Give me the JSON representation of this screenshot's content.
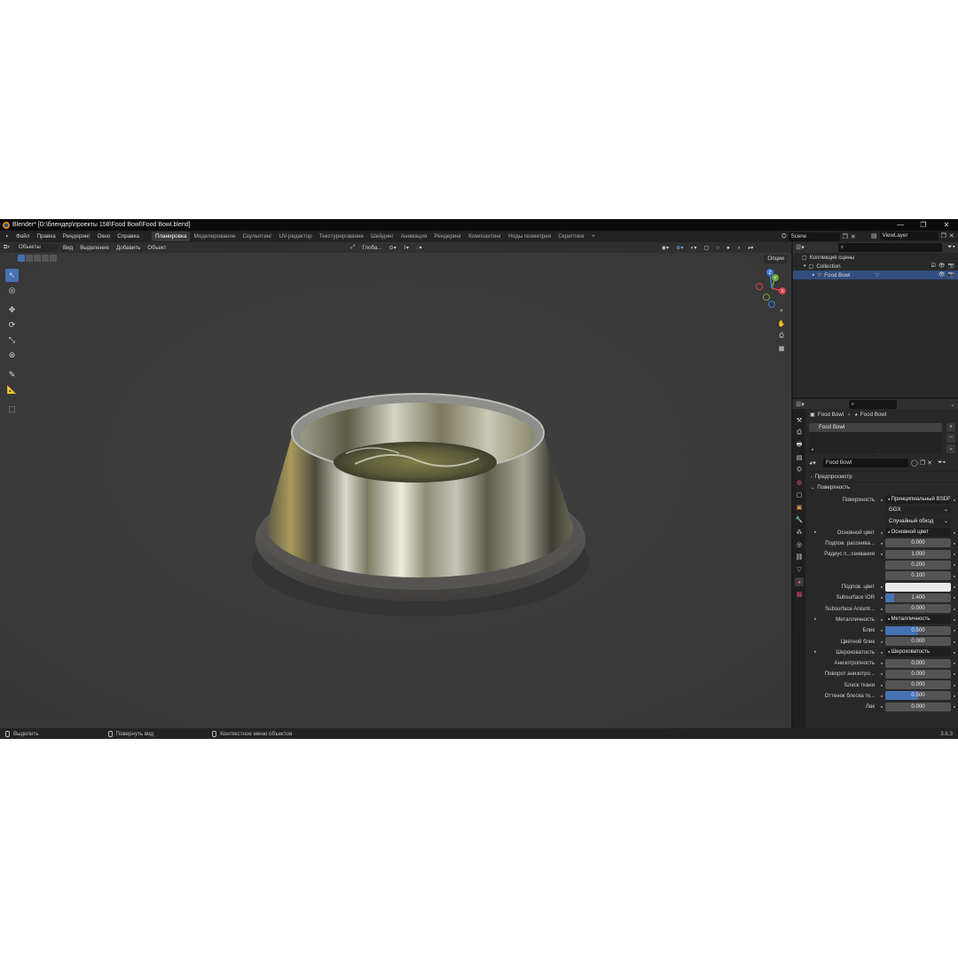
{
  "window": {
    "title": "Blender* [D:\\блендер\\проекты 158\\Food Bowl\\Food Bowl.blend]",
    "controls": [
      "—",
      "❐",
      "✕"
    ]
  },
  "menu": {
    "items": [
      "Файл",
      "Правка",
      "Рендеринг",
      "Окно",
      "Справка"
    ],
    "workspaces": [
      "Планировка",
      "Моделирование",
      "Скульптинг",
      "UV-редактор",
      "Текстурирование",
      "Шейдинг",
      "Анимация",
      "Рендеринг",
      "Композитинг",
      "Ноды геометрии",
      "Скриптинг"
    ],
    "active_workspace": "Планировка",
    "scene": "Scene",
    "view_layer": "ViewLayer"
  },
  "viewport": {
    "mode": "Объекты",
    "menus": [
      "Вид",
      "Выделение",
      "Добавить",
      "Объект"
    ],
    "orientation": "Глоба...",
    "options_label": "Опции",
    "gizmo_axes": [
      "X",
      "Y",
      "Z"
    ]
  },
  "outliner": {
    "rows": [
      {
        "label": "Коллекция сцены"
      },
      {
        "label": "Collection"
      },
      {
        "label": "Food Bowl"
      }
    ]
  },
  "properties": {
    "breadcrumb": [
      "Food Bowl",
      "Food Bowl"
    ],
    "material_slot": "Food Bowl",
    "material_name": "Food Bowl",
    "panels": {
      "preview": "Предпросмотр",
      "surface": "Поверхность"
    },
    "rows": [
      {
        "label": "Поверхность",
        "value": "Принципиальный BSDF",
        "kind": "link"
      },
      {
        "label": "",
        "value": "GGX",
        "kind": "dark"
      },
      {
        "label": "",
        "value": "Случайный обход",
        "kind": "dark"
      },
      {
        "label": "Основной цвет",
        "value": "Основной цвет",
        "kind": "link",
        "expand": true
      },
      {
        "label": "Подпов. рассеива...",
        "value": "0.000",
        "kind": "num",
        "fill": 0
      },
      {
        "label": "Радиус п...сеивания",
        "value": "1.000",
        "kind": "num",
        "fill": 0
      },
      {
        "label": "",
        "value": "0.200",
        "kind": "num",
        "fill": 0
      },
      {
        "label": "",
        "value": "0.100",
        "kind": "num",
        "fill": 0
      },
      {
        "label": "Подпов. цвет",
        "value": "",
        "kind": "white"
      },
      {
        "label": "Subsurface IOR",
        "value": "1.400",
        "kind": "num",
        "fill": 0.14
      },
      {
        "label": "Subsurface Anisotr...",
        "value": "0.000",
        "kind": "num",
        "fill": 0
      },
      {
        "label": "Металличность",
        "value": "Металличность",
        "kind": "link",
        "expand": true
      },
      {
        "label": "Блик",
        "value": "0.500",
        "kind": "num",
        "fill": 0.5
      },
      {
        "label": "Цветной блик",
        "value": "0.000",
        "kind": "num",
        "fill": 0
      },
      {
        "label": "Шероховатость",
        "value": "Шероховатость",
        "kind": "link",
        "expand": true
      },
      {
        "label": "Анизотропность",
        "value": "0.000",
        "kind": "num",
        "fill": 0
      },
      {
        "label": "Поворот анизотро...",
        "value": "0.000",
        "kind": "num",
        "fill": 0
      },
      {
        "label": "Блеск ткани",
        "value": "0.000",
        "kind": "num",
        "fill": 0
      },
      {
        "label": "Оттенок блеска тк...",
        "value": "0.500",
        "kind": "num",
        "fill": 0.5
      },
      {
        "label": "Лак",
        "value": "0.000",
        "kind": "num",
        "fill": 0
      }
    ]
  },
  "status": {
    "items": [
      "Выделить",
      "Повернуть вид",
      "Контекстное меню объектов"
    ],
    "version": "3.6.3"
  },
  "colors": {
    "accent": "#4772b3",
    "selection": "#334d80",
    "viewport_bg": "#3b3b3b",
    "axis_x": "#d8404f",
    "axis_y": "#6ba83a",
    "axis_z": "#3f7bd8"
  },
  "icons": [
    "select-box-icon",
    "cursor-icon",
    "move-icon",
    "rotate-icon",
    "scale-icon",
    "transform-icon",
    "annotate-icon",
    "measure-icon",
    "add-cube-icon",
    "zoom-icon",
    "hand-icon",
    "camera-icon",
    "grid-icon",
    "eye-icon",
    "render-camera-icon",
    "material-icon"
  ]
}
